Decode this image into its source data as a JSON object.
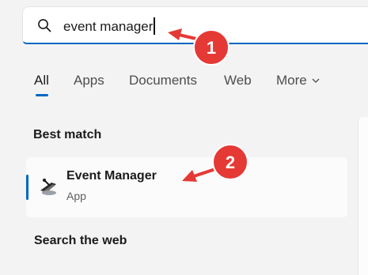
{
  "search": {
    "query": "event manager",
    "icon": "search-icon"
  },
  "tabs": [
    {
      "label": "All",
      "active": true
    },
    {
      "label": "Apps"
    },
    {
      "label": "Documents"
    },
    {
      "label": "Web"
    },
    {
      "label": "More"
    }
  ],
  "best_match": {
    "heading": "Best match",
    "result": {
      "name": "Event Manager",
      "type": "App",
      "icon": "event-manager-app-icon"
    }
  },
  "search_web": {
    "heading": "Search the web"
  },
  "annotations": [
    {
      "number": "1"
    },
    {
      "number": "2"
    }
  ],
  "colors": {
    "accent": "#0067c0",
    "annotation": "#e53935",
    "background": "#f3f3f3"
  }
}
